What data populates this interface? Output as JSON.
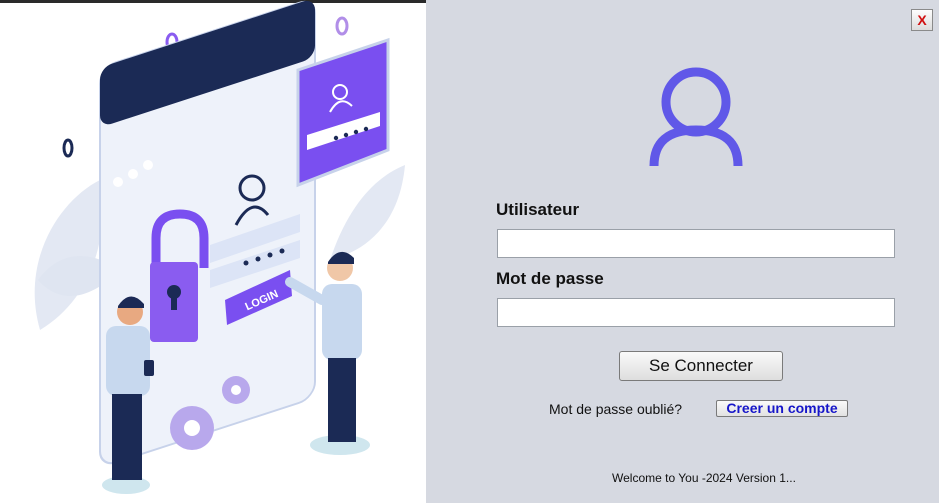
{
  "window": {
    "close_label": "X"
  },
  "form": {
    "username_label": "Utilisateur",
    "username_value": "",
    "password_label": "Mot de passe",
    "password_value": "",
    "connect_label": "Se Connecter",
    "forgot_label": "Mot de passe oublié?",
    "create_account_label": "Creer un compte"
  },
  "illustration": {
    "login_badge": "LOGIN"
  },
  "footer": {
    "text": "Welcome to You -2024 Version 1..."
  },
  "colors": {
    "accent": "#6058e8",
    "panel_bg": "#d6d9e1",
    "link": "#1717c9",
    "close": "#d01010"
  },
  "icons": {
    "avatar": "user-outline-icon",
    "close": "close-icon"
  }
}
